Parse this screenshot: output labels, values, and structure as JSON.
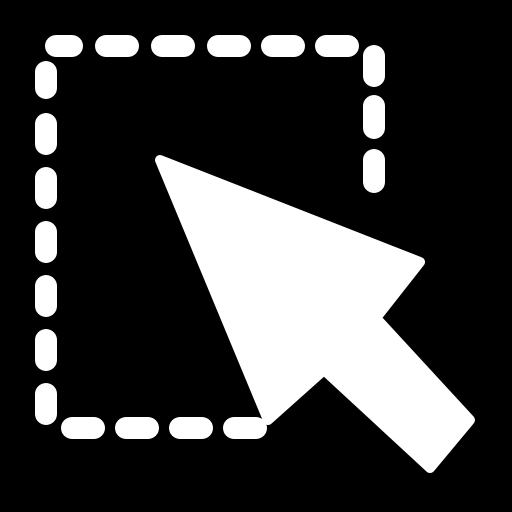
{
  "icon": {
    "name": "selection-cursor-icon",
    "parts": [
      "dashed-selection-rectangle",
      "arrow-pointer"
    ]
  },
  "colors": {
    "background": "#000000",
    "foreground": "#ffffff"
  }
}
